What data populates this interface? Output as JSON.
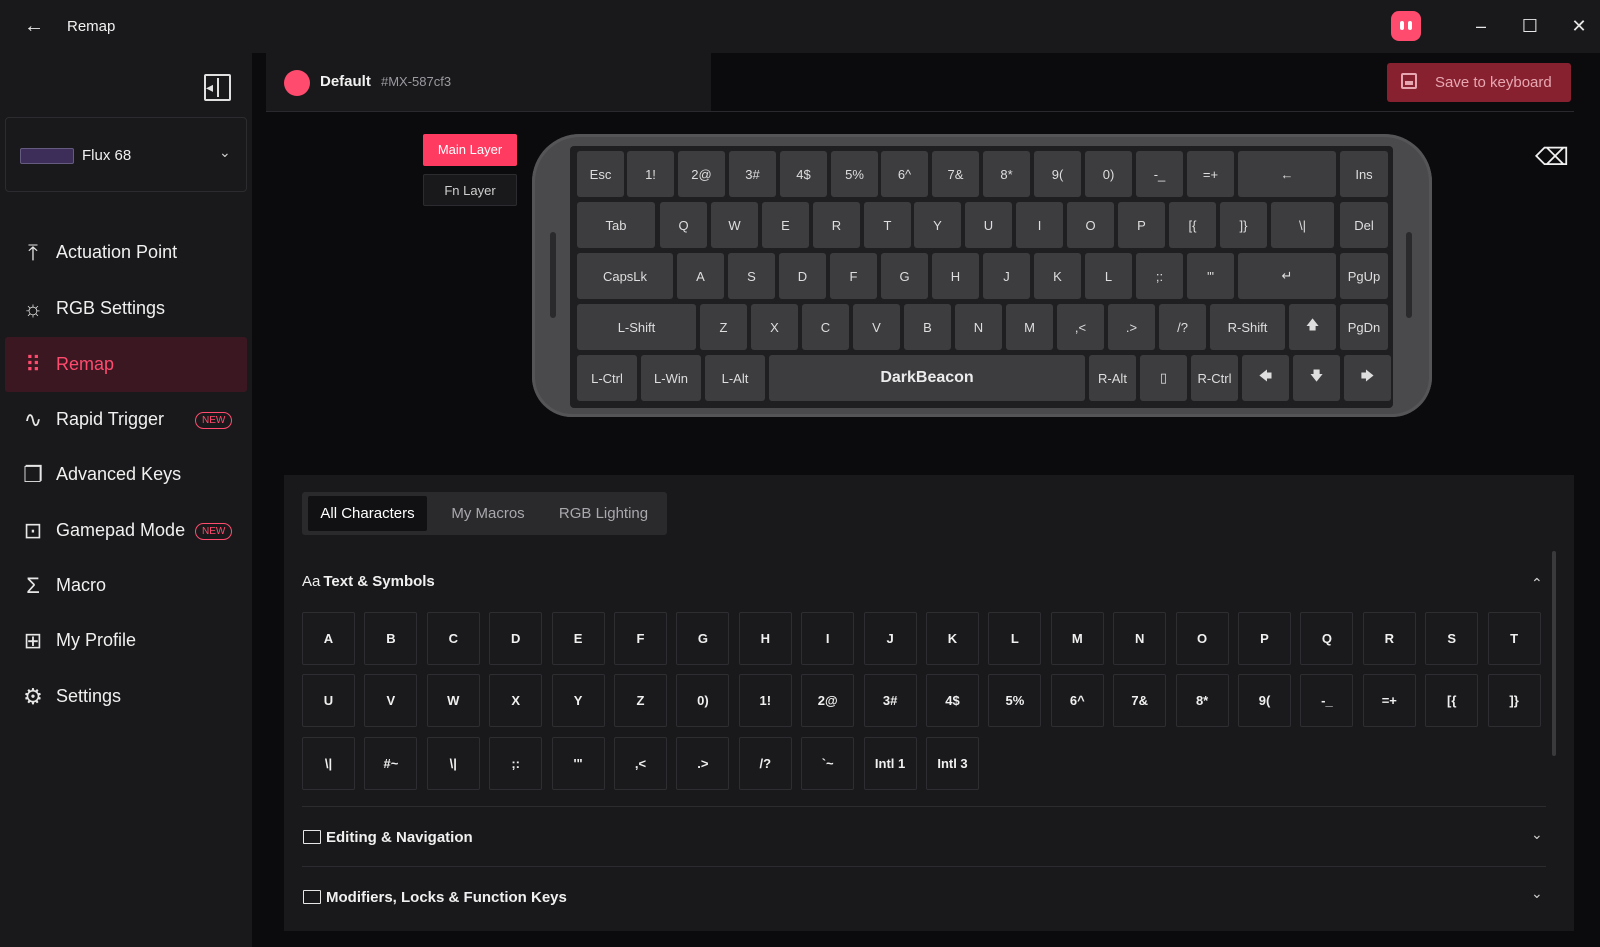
{
  "window": {
    "title": "Remap",
    "minimize": "–",
    "maximize": "☐",
    "close": "✕"
  },
  "sidebar": {
    "device": "Flux 68",
    "items": [
      {
        "label": "Actuation Point",
        "icon": "actuation-icon",
        "glyph": "⤒"
      },
      {
        "label": "RGB Settings",
        "icon": "sun-icon",
        "glyph": "☼"
      },
      {
        "label": "Remap",
        "icon": "keyboard-grid-icon",
        "glyph": "⠿"
      },
      {
        "label": "Rapid Trigger",
        "icon": "pulse-icon",
        "glyph": "∿",
        "badge": "NEW"
      },
      {
        "label": "Advanced Keys",
        "icon": "layers-icon",
        "glyph": "❐"
      },
      {
        "label": "Gamepad Mode",
        "icon": "gamepad-icon",
        "glyph": "⊡",
        "badge": "NEW"
      },
      {
        "label": "Macro",
        "icon": "sigma-icon",
        "glyph": "Σ"
      },
      {
        "label": "My Profile",
        "icon": "grid-plus-icon",
        "glyph": "⊞"
      },
      {
        "label": "Settings",
        "icon": "gear-icon",
        "glyph": "⚙"
      }
    ]
  },
  "profile": {
    "name": "Default",
    "id": "#MX-587cf3"
  },
  "save_button": "Save to keyboard",
  "layers": {
    "main": "Main Layer",
    "fn": "Fn Layer"
  },
  "keyboard": {
    "rows": [
      [
        "Esc",
        "1!",
        "2@",
        "3#",
        "4$",
        "5%",
        "6^",
        "7&",
        "8*",
        "9(",
        "0)",
        "-_",
        "=+",
        "←",
        "Ins"
      ],
      [
        "Tab",
        "Q",
        "W",
        "E",
        "R",
        "T",
        "Y",
        "U",
        "I",
        "O",
        "P",
        "[{",
        "]}",
        "\\|",
        "Del"
      ],
      [
        "CapsLk",
        "A",
        "S",
        "D",
        "F",
        "G",
        "H",
        "J",
        "K",
        "L",
        ";:",
        "'\"",
        "↵",
        "PgUp"
      ],
      [
        "L-Shift",
        "Z",
        "X",
        "C",
        "V",
        "B",
        "N",
        "M",
        ",<",
        ".>",
        "/?",
        "R-Shift",
        "🡅",
        "PgDn"
      ],
      [
        "L-Ctrl",
        "L-Win",
        "L-Alt",
        "DarkBeacon",
        "R-Alt",
        "▯",
        "R-Ctrl",
        "🡄",
        "🡇",
        "🡆"
      ]
    ]
  },
  "palette": {
    "tabs": [
      "All Characters",
      "My Macros",
      "RGB Lighting"
    ],
    "sections": [
      {
        "title": "Text & Symbols",
        "icon": "text-icon",
        "glyph": "Aa",
        "expanded": true
      },
      {
        "title": "Editing & Navigation",
        "icon": "keyboard-icon",
        "expanded": false
      },
      {
        "title": "Modifiers, Locks & Function Keys",
        "icon": "keyboard-icon",
        "expanded": false
      }
    ],
    "chars_row1": [
      "A",
      "B",
      "C",
      "D",
      "E",
      "F",
      "G",
      "H",
      "I",
      "J",
      "K",
      "L",
      "M",
      "N",
      "O",
      "P",
      "Q",
      "R",
      "S",
      "T"
    ],
    "chars_row2": [
      "U",
      "V",
      "W",
      "X",
      "Y",
      "Z",
      "0)",
      "1!",
      "2@",
      "3#",
      "4$",
      "5%",
      "6^",
      "7&",
      "8*",
      "9(",
      "-_",
      "=+",
      "[{",
      "]}"
    ],
    "chars_row3": [
      "\\|",
      "#~",
      "\\|",
      ";:",
      "'\"",
      ",<",
      ".>",
      "/?",
      "`~",
      "Intl 1",
      "Intl 3"
    ]
  },
  "colors": {
    "accent": "#ff4b6e",
    "accent_dark": "#87202f",
    "bg": "#0b0b0d",
    "panel": "#19191b",
    "key": "#3d3d40"
  }
}
